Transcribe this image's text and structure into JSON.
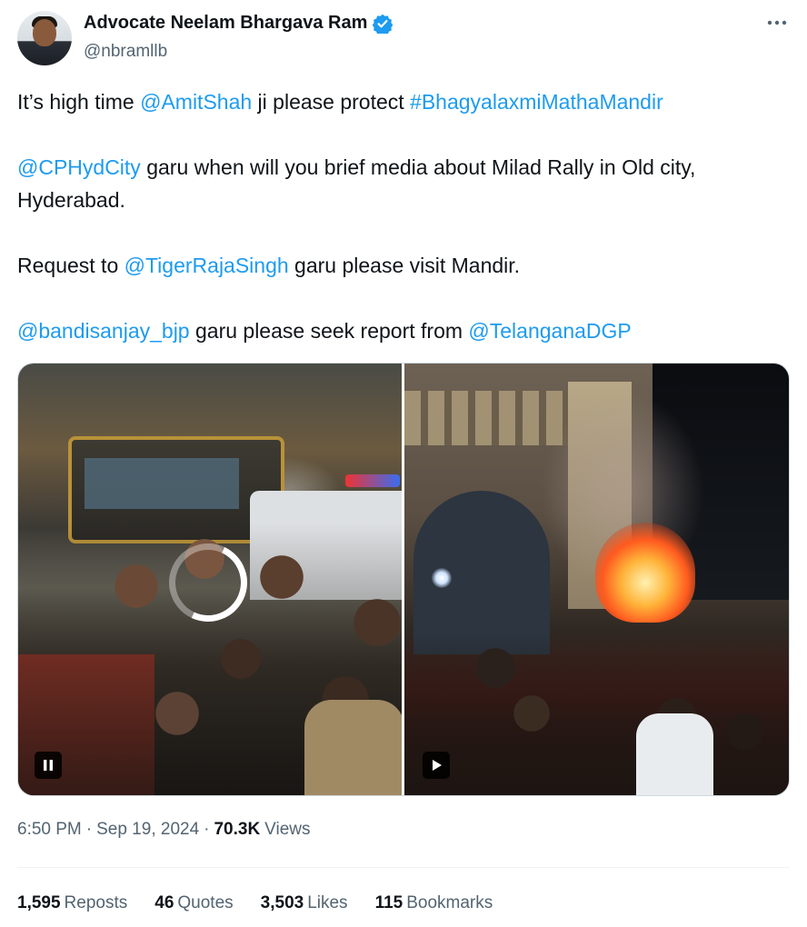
{
  "author": {
    "display_name": "Advocate Neelam Bhargava Ram",
    "handle": "@nbramllb",
    "verified": true
  },
  "tweet": {
    "lines": [
      [
        {
          "text": "It’s high time ",
          "link": false
        },
        {
          "text": "@AmitShah",
          "link": true
        },
        {
          "text": " ji please protect ",
          "link": false
        },
        {
          "text": "#BhagyalaxmiMathaMandir",
          "link": true
        }
      ],
      [
        {
          "text": "@CPHydCity",
          "link": true
        },
        {
          "text": " garu when will you brief media about Milad Rally in Old city, Hyderabad.",
          "link": false
        }
      ],
      [
        {
          "text": "Request to ",
          "link": false
        },
        {
          "text": "@TigerRajaSingh",
          "link": true
        },
        {
          "text": " garu please visit Mandir.",
          "link": false
        }
      ],
      [
        {
          "text": "@bandisanjay_bjp",
          "link": true
        },
        {
          "text": " garu please seek report from ",
          "link": false
        },
        {
          "text": "@TelanganaDGP",
          "link": true
        }
      ]
    ]
  },
  "media": {
    "left_video": {
      "control": "pause-icon",
      "loading": true
    },
    "right_video": {
      "control": "play-icon"
    }
  },
  "meta": {
    "time": "6:50 PM",
    "date": "Sep 19, 2024",
    "views_count": "70.3K",
    "views_label": "Views",
    "separator": "·"
  },
  "stats": [
    {
      "count": "1,595",
      "label": "Reposts"
    },
    {
      "count": "46",
      "label": "Quotes"
    },
    {
      "count": "3,503",
      "label": "Likes"
    },
    {
      "count": "115",
      "label": "Bookmarks"
    }
  ],
  "colors": {
    "link": "#1d9bf0",
    "text": "#0f1419",
    "secondary": "#536471",
    "verified": "#1d9bf0"
  }
}
